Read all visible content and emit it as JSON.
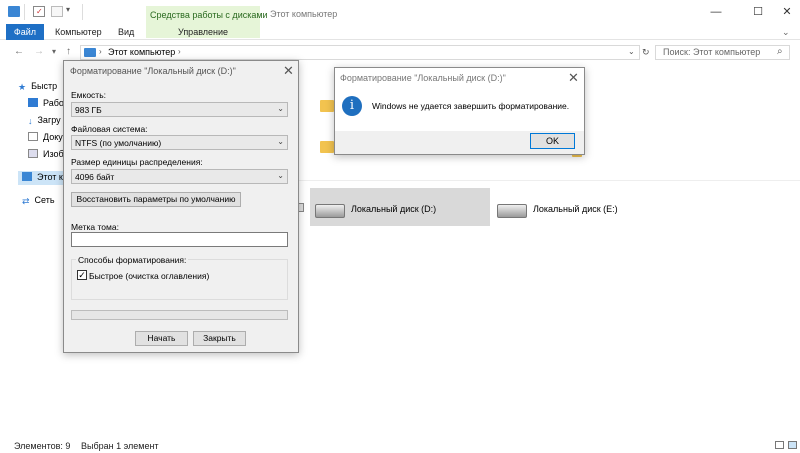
{
  "window": {
    "title": "Этот компьютер",
    "tools_tab": "Средства работы с дисками",
    "minimize": "—",
    "maximize": "☐",
    "close": "✕"
  },
  "ribbon": {
    "tabs": [
      "Файл",
      "Компьютер",
      "Вид",
      "Управление"
    ]
  },
  "address": {
    "path": "Этот компьютер",
    "search_placeholder": "Поиск: Этот компьютер"
  },
  "sidebar": {
    "items": [
      {
        "label": "Быстр",
        "icon": "star-icon"
      },
      {
        "label": "Рабоч",
        "icon": "desktop-icon"
      },
      {
        "label": "Загру",
        "icon": "download-icon"
      },
      {
        "label": "Доку",
        "icon": "document-icon"
      },
      {
        "label": "Изоб",
        "icon": "picture-icon"
      },
      {
        "label": "Этот ко",
        "icon": "computer-icon"
      },
      {
        "label": "Сеть",
        "icon": "network-icon"
      }
    ]
  },
  "drives": [
    {
      "label": "Локальный диск (D:)",
      "selected": true
    },
    {
      "label": "Локальный диск (E:)",
      "selected": false
    }
  ],
  "status": {
    "items": "Элементов: 9",
    "selected": "Выбран 1 элемент"
  },
  "format_dialog": {
    "title": "Форматирование \"Локальный диск (D:)\"",
    "capacity_label": "Емкость:",
    "capacity_value": "983 ГБ",
    "fs_label": "Файловая система:",
    "fs_value": "NTFS (по умолчанию)",
    "alloc_label": "Размер единицы распределения:",
    "alloc_value": "4096 байт",
    "restore_button": "Восстановить параметры по умолчанию",
    "volume_label": "Метка тома:",
    "volume_value": "",
    "options_label": "Способы форматирования:",
    "quick_label": "Быстрое (очистка оглавления)",
    "quick_checked": "✓",
    "start_button": "Начать",
    "close_button": "Закрыть",
    "close_x": "✕"
  },
  "error_dialog": {
    "title": "Форматирование \"Локальный диск (D:)\"",
    "icon_glyph": "i",
    "message": "Windows не удается завершить форматирование.",
    "ok_button": "OK",
    "close_x": "✕"
  },
  "colors": {
    "accent": "#1e6fc5",
    "tools_tab_bg": "#e6f5d8",
    "selection": "#cce4f7",
    "info_icon": "#1f6fbf"
  }
}
